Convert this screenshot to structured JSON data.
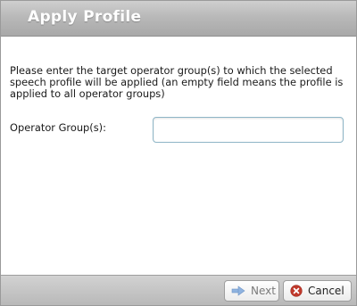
{
  "dialog": {
    "title": "Apply Profile",
    "instructions": "Please enter the target operator group(s) to which the selected speech profile will be applied (an empty field means the profile is applied to all operator groups)",
    "field": {
      "label": "Operator Group(s):",
      "value": "",
      "placeholder": ""
    },
    "buttons": {
      "next": {
        "label": "Next",
        "icon": "arrow-right-icon",
        "enabled": false
      },
      "cancel": {
        "label": "Cancel",
        "icon": "close-circle-icon",
        "enabled": true
      }
    }
  },
  "colors": {
    "titlebar": "#b9b9b9",
    "title_text": "#ffffff",
    "input_border": "#8fb6c7",
    "cancel_icon": "#c0392b",
    "next_icon": "#8fb3e0"
  }
}
